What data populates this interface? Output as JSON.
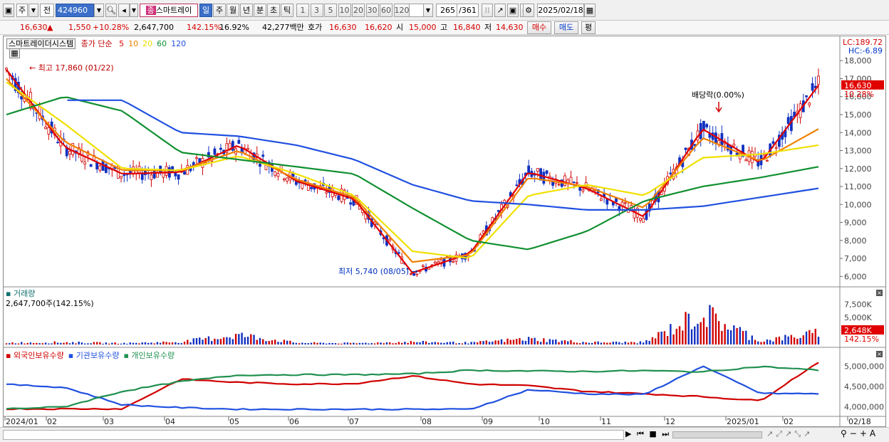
{
  "toolbar": {
    "market": "주",
    "prefix": "전",
    "code": "424960",
    "name": "스마트레이",
    "periods": [
      "일",
      "주",
      "월",
      "년",
      "분",
      "초",
      "틱"
    ],
    "intervals": [
      "1",
      "3",
      "5",
      "10",
      "20",
      "30",
      "60",
      "120"
    ],
    "count": "265",
    "total": "/361",
    "date": "2025/02/18"
  },
  "quote": {
    "price": "16,630",
    "arrow": "▲",
    "change": "1,550",
    "change_pct": "+10.28%",
    "volume": "2,647,700",
    "vol_ratio": "142.15%",
    "turnover": "16.92%",
    "amount": "42,277백만",
    "bid_label": "호가",
    "ask": "16,630",
    "bid": "16,620",
    "open_label": "시",
    "open": "15,000",
    "high_label": "고",
    "high": "16,840",
    "low_label": "저",
    "low": "14,630",
    "buy_button": "매수",
    "sell_button": "매도",
    "eval_button": "평"
  },
  "price_panel": {
    "title": "스마트레이더시스템",
    "legend_label": "종가 단순",
    "ma_periods": [
      {
        "label": "5",
        "color": "#e00000"
      },
      {
        "label": "10",
        "color": "#f08000"
      },
      {
        "label": "20",
        "color": "#f0e000"
      },
      {
        "label": "60",
        "color": "#109030"
      },
      {
        "label": "120",
        "color": "#2050e0"
      }
    ],
    "lc_label": "LC:189.72",
    "hc_label": "HC:-6.89",
    "last_price_tag": "16,630",
    "last_pct_tag": "10.28%",
    "high_annotation": "최고 17,860 (01/22)",
    "low_annotation": "최저 5,740 (08/05)",
    "dividend_annotation": "배당락(0.00%)",
    "y_ticks": [
      "18,000",
      "17,000",
      "16,000",
      "15,000",
      "14,000",
      "13,000",
      "12,000",
      "11,000",
      "10,000",
      "9,000",
      "8,000",
      "7,000",
      "6,000"
    ]
  },
  "volume_panel": {
    "title": "거래량",
    "value": "2,647,700주(142.15%)",
    "y_ticks": [
      "7,500K",
      "5,000K",
      "2,500K"
    ],
    "last_tag": "2,648K",
    "last_pct": "142.15%"
  },
  "holding_panel": {
    "series": [
      {
        "name": "외국인보유수량",
        "color": "#d00000"
      },
      {
        "name": "기관보유수량",
        "color": "#2050e0"
      },
      {
        "name": "개인보유수량",
        "color": "#209050"
      }
    ],
    "y_ticks": [
      "5,000,000",
      "4,500,000",
      "4,000,000"
    ]
  },
  "x_axis": [
    "2024/01",
    "02",
    "03",
    "04",
    "05",
    "06",
    "07",
    "08",
    "09",
    "10",
    "11",
    "12",
    "2025/01",
    "02",
    "02/18"
  ],
  "chart_data": {
    "type": "line",
    "title": "스마트레이더시스템",
    "ylim": [
      5500,
      18800
    ],
    "x": [
      "2024/01",
      "02",
      "03",
      "04",
      "05",
      "06",
      "07",
      "08",
      "09",
      "10",
      "11",
      "12",
      "2025/01",
      "02",
      "02/18"
    ],
    "series": [
      {
        "name": "5",
        "values": [
          17500,
          13200,
          11700,
          11800,
          13300,
          11300,
          10300,
          6200,
          7300,
          11800,
          10900,
          9300,
          14200,
          12300,
          16630
        ]
      },
      {
        "name": "10",
        "values": [
          17000,
          13500,
          11900,
          11900,
          13000,
          11400,
          10400,
          6800,
          7200,
          11500,
          11000,
          9800,
          13700,
          12400,
          14200
        ]
      },
      {
        "name": "20",
        "values": [
          16800,
          14500,
          12000,
          11900,
          12700,
          11700,
          10500,
          7400,
          7000,
          10500,
          11100,
          10500,
          12600,
          12800,
          13300
        ]
      },
      {
        "name": "60",
        "values": [
          15000,
          16000,
          15200,
          12900,
          12500,
          12100,
          11700,
          9800,
          8000,
          7500,
          8500,
          10200,
          11000,
          11500,
          12100
        ]
      },
      {
        "name": "120",
        "values": [
          null,
          null,
          15800,
          14000,
          13800,
          13300,
          12500,
          11100,
          10200,
          10000,
          9700,
          9700,
          9900,
          10400,
          10900
        ]
      }
    ],
    "volume": [
      0.4,
      0.5,
      0.3,
      0.6,
      2.2,
      0.4,
      0.3,
      0.6,
      0.4,
      1.3,
      0.5,
      0.5,
      7.2,
      0.8,
      2.6
    ]
  }
}
